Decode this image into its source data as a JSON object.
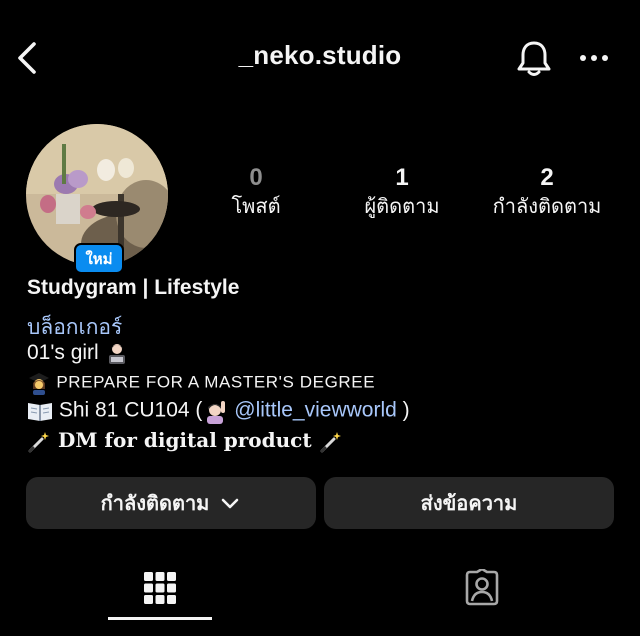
{
  "header": {
    "username": "_neko.studio",
    "back_icon": "chevron-left-icon",
    "notification_icon": "bell-icon",
    "more_icon": "more-horizontal-icon"
  },
  "profile": {
    "new_badge": "ใหม่",
    "stats": {
      "posts_count": "0",
      "posts_label": "โพสต์",
      "followers_count": "1",
      "followers_label": "ผู้ติดตาม",
      "following_count": "2",
      "following_label": "กำลังติดตาม"
    },
    "bio": {
      "name": "Studygram | Lifestyle",
      "category": "บล็อกเกอร์",
      "line1_text": "01's girl",
      "line2_text": "PREPARE FOR A MASTER'S DEGREE",
      "line3_prefix": "Shi 81 CU104 (",
      "line3_mention": "@little_viewworld",
      "line3_suffix": ")",
      "line4_text": "DM for digital product"
    }
  },
  "actions": {
    "following_button": "กำลังติดตาม",
    "message_button": "ส่งข้อความ"
  },
  "tabs": {
    "grid_icon": "grid-icon",
    "tagged_icon": "tagged-person-icon",
    "active_tab": "grid"
  },
  "colors": {
    "background": "#000000",
    "button_bg": "#262626",
    "link": "#a8c7fa",
    "badge": "#0a8cf0",
    "muted": "#8e8e8e"
  }
}
